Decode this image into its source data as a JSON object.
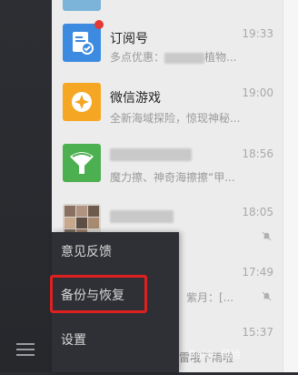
{
  "chats": [
    {
      "name": "订阅号",
      "preview": "多点优惠：",
      "preview_tail": "植物...",
      "time": "19:33"
    },
    {
      "name": "微信游戏",
      "preview": "全新海域探险，惊现神秘...",
      "time": "19:00"
    },
    {
      "name": "",
      "preview": "魔力擦、神奇海擦擦“甲...",
      "time": "18:56"
    },
    {
      "name": "",
      "preview": "",
      "time": "18:05"
    },
    {
      "name": "",
      "preview": "紫月：[...",
      "time": "17:49"
    },
    {
      "name": "",
      "preview": "雷哦下雨啦",
      "time": "15:37"
    }
  ],
  "menu": {
    "feedback": "意见反馈",
    "backup": "备份与恢复",
    "settings": "设置"
  },
  "watermark": "Baidu 经验"
}
